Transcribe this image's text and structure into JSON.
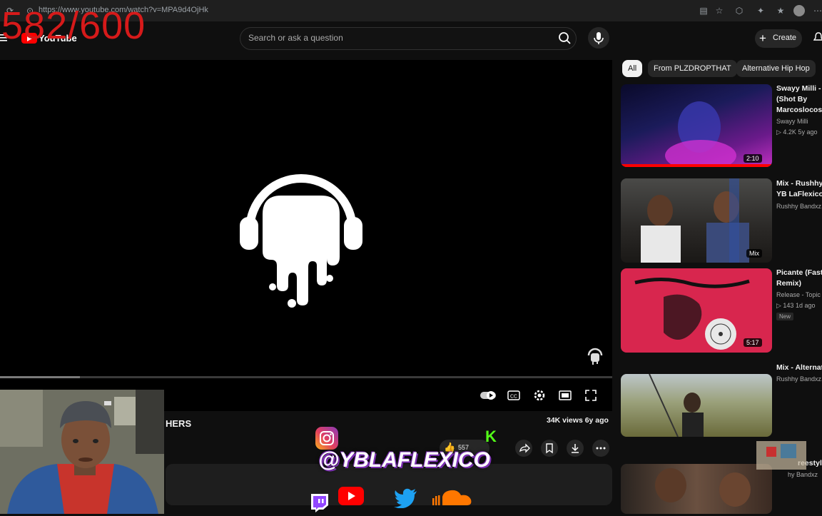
{
  "browser": {
    "url": "https://www.youtube.com/watch?v=MPA9d4OjHk"
  },
  "overlay_counter": "582/600",
  "masthead": {
    "logo_text": "YouTube",
    "search_placeholder": "Search or ask a question",
    "create_label": "Create"
  },
  "video": {
    "title_fragment": "HERS",
    "meta": "34K views  6y ago",
    "likes": "557"
  },
  "chips": [
    "All",
    "From PLZDROPTHAT",
    "Alternative Hip Hop"
  ],
  "recommendations": [
    {
      "title1": "Swayy Milli - I",
      "title2": "(Shot By",
      "title3": "Marcoslocost",
      "channel": "Swayy Milli",
      "stats": "▷ 4.2K  5y ago",
      "duration": "2:10"
    },
    {
      "title1": "Mix - Rushhy",
      "title2": "YB LaFlexico",
      "channel": "Rushhy Bandxz,",
      "duration": "Mix"
    },
    {
      "title1": "Picante (Faste",
      "title2": "Remix)",
      "channel": "Release - Topic",
      "stats": "▷ 143  1d ago",
      "badge": "New",
      "duration": "5:17"
    },
    {
      "title1": "Mix - Alternat",
      "channel": "Rushhy Bandxz,"
    },
    {
      "title1": "reestyl",
      "channel": "hy Bandxz"
    }
  ],
  "social_overlay": {
    "handle": "@YBLAFLEXICO",
    "k_letter": "K"
  },
  "colors": {
    "counter": "#d61a1a",
    "accent": "#ff0000",
    "background": "#0f0f0f"
  }
}
